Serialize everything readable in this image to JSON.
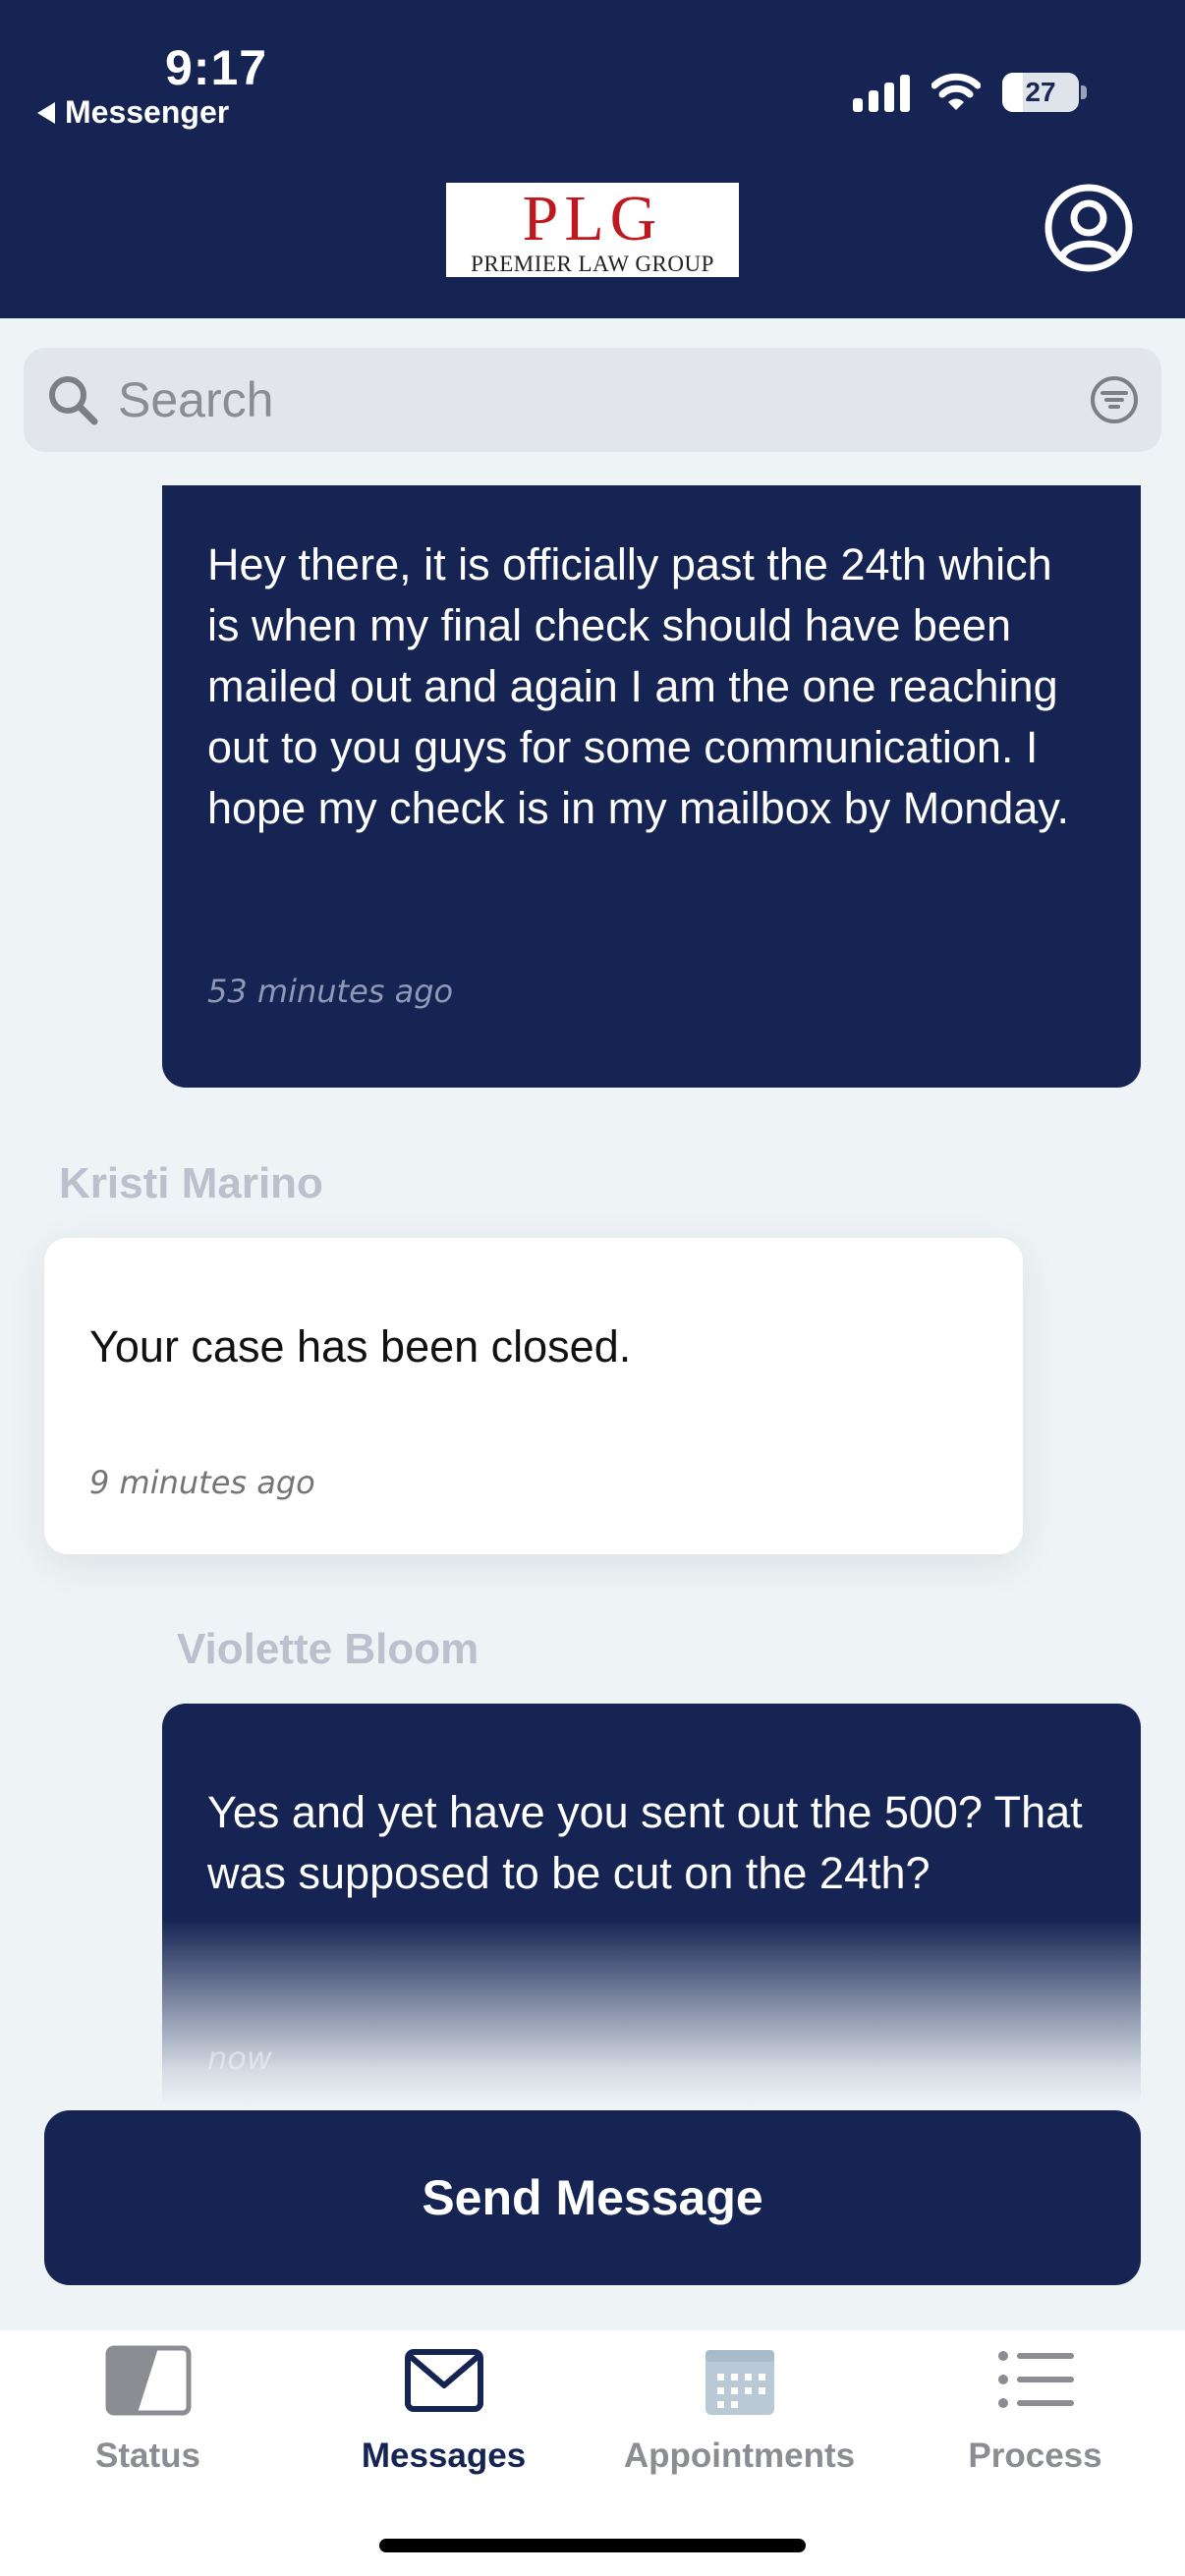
{
  "status_bar": {
    "time": "9:17",
    "back_label": "Messenger",
    "battery_level": "27"
  },
  "header": {
    "logo_main": "PLG",
    "logo_sub": "PREMIER LAW GROUP",
    "profile_icon": "user-circle-icon"
  },
  "search": {
    "placeholder": "Search",
    "icon": "search-icon",
    "filter_icon": "filter-icon"
  },
  "messages": [
    {
      "direction": "outgoing",
      "text": "Hey there, it is officially past the 24th which is when my final check should have been mailed out and again I am the one reaching out to you guys for some communication. I hope my check is in my mailbox by Monday.",
      "time": "53 minutes ago"
    },
    {
      "direction": "incoming",
      "sender": "Kristi Marino",
      "text": "Your case has been closed.",
      "time": "9 minutes ago"
    },
    {
      "direction": "outgoing",
      "sender": "Violette Bloom",
      "text": "Yes and yet have you sent out the 500? That was supposed to be cut on the 24th?",
      "time": "now"
    }
  ],
  "send_button": {
    "label": "Send Message"
  },
  "tabs": [
    {
      "label": "Status",
      "icon": "status-icon",
      "active": false
    },
    {
      "label": "Messages",
      "icon": "envelope-icon",
      "active": true
    },
    {
      "label": "Appointments",
      "icon": "calendar-icon",
      "active": false
    },
    {
      "label": "Process",
      "icon": "list-icon",
      "active": false
    }
  ],
  "colors": {
    "navy": "#152453",
    "logo_red": "#c0181f",
    "background": "#eef3f6"
  }
}
